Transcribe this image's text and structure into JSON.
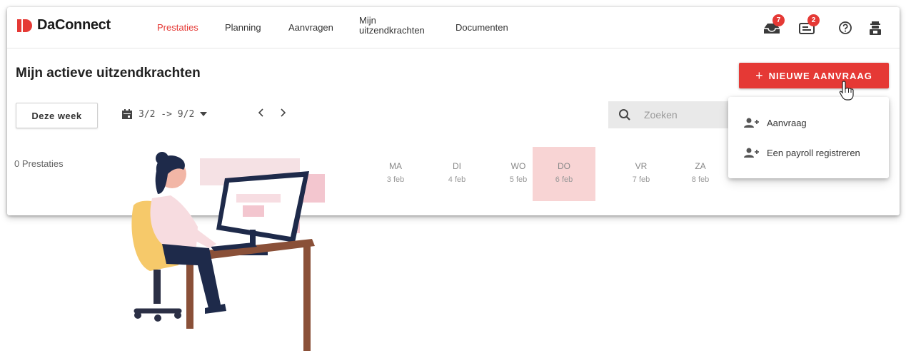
{
  "brand": {
    "name": "DaConnect",
    "color": "#e53935"
  },
  "nav": {
    "items": [
      {
        "label": "Prestaties",
        "active": true
      },
      {
        "label": "Planning",
        "active": false
      },
      {
        "label": "Aanvragen",
        "active": false
      },
      {
        "label_line1": "Mijn",
        "label_line2": "uitzendkrachten",
        "active": false
      },
      {
        "label": "Documenten",
        "active": false
      }
    ]
  },
  "top_icons": {
    "inbox": {
      "icon": "inbox-icon",
      "badge": "7"
    },
    "messages": {
      "icon": "message-icon",
      "badge": "2"
    },
    "help": {
      "icon": "help-icon"
    },
    "profile": {
      "icon": "profile-icon"
    }
  },
  "page": {
    "title": "Mijn actieve uitzendkrachten",
    "new_button": {
      "plus": "+",
      "label": "NIEUWE AANVRAAG"
    },
    "week_button": "Deze week",
    "range": "3/2 -> 9/2",
    "search_placeholder": "Zoeken",
    "count": "0 Prestaties",
    "days": [
      {
        "name": "MA",
        "date": "3 feb",
        "today": false
      },
      {
        "name": "DI",
        "date": "4 feb",
        "today": false
      },
      {
        "name": "WO",
        "date": "5 feb",
        "today": false
      },
      {
        "name": "DO",
        "date": "6 feb",
        "today": true
      },
      {
        "name": "VR",
        "date": "7 feb",
        "today": false
      },
      {
        "name": "ZA",
        "date": "8 feb",
        "today": false
      }
    ]
  },
  "dropdown": {
    "items": [
      {
        "label": "Aanvraag",
        "icon": "add-person-icon"
      },
      {
        "label": "Een payroll registreren",
        "icon": "add-person-icon"
      }
    ]
  },
  "colors": {
    "accent": "#e53935",
    "today_bg": "#f8d4d4",
    "search_bg": "#e9e9e9"
  }
}
